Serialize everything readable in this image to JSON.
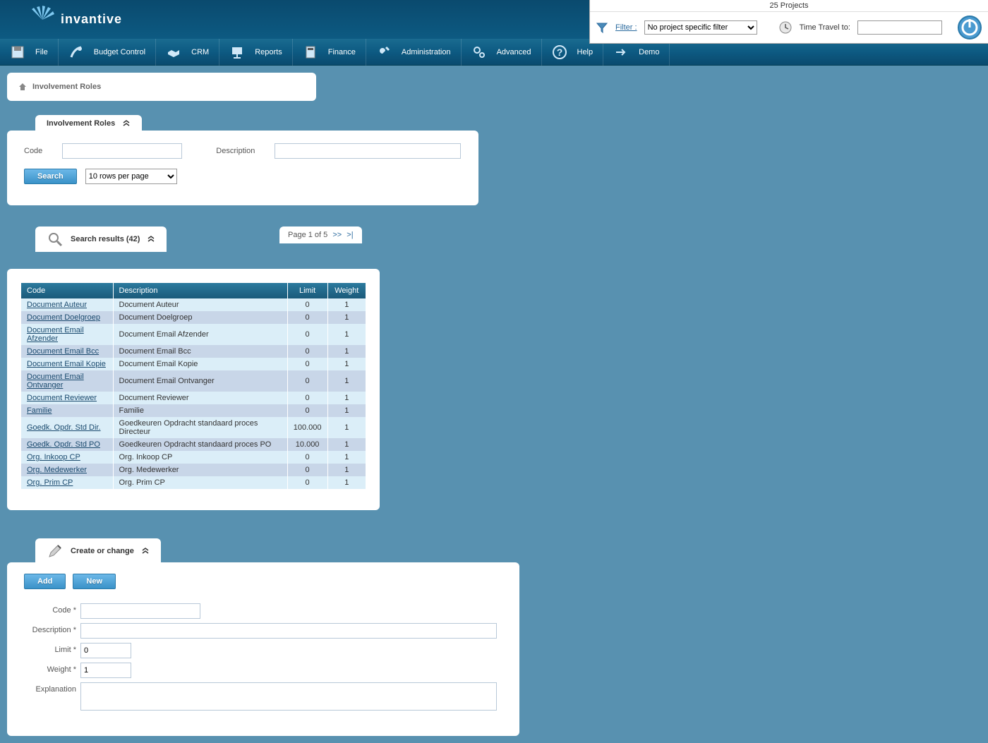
{
  "topbar": {
    "projects_count": "25 Projects",
    "filter_label": "Filter :",
    "filter_selected": "No project specific filter",
    "timetravel_label": "Time Travel to:",
    "timetravel_value": ""
  },
  "logo": {
    "text": "invantive"
  },
  "menu": [
    {
      "label": "File",
      "icon": "save"
    },
    {
      "label": "Budget Control",
      "icon": "budget"
    },
    {
      "label": "CRM",
      "icon": "handshake"
    },
    {
      "label": "Reports",
      "icon": "presentation"
    },
    {
      "label": "Finance",
      "icon": "calculator"
    },
    {
      "label": "Administration",
      "icon": "wrench"
    },
    {
      "label": "Advanced",
      "icon": "gears"
    },
    {
      "label": "Help",
      "icon": "help"
    },
    {
      "label": "Demo",
      "icon": "arrow"
    }
  ],
  "breadcrumb": {
    "title": "Involvement Roles"
  },
  "search_panel": {
    "title": "Involvement Roles",
    "code_label": "Code",
    "desc_label": "Description",
    "search_btn": "Search",
    "rows_selected": "10 rows per page"
  },
  "results": {
    "title": "Search results (42)",
    "pager": "Page 1 of 5",
    "pager_next": ">>",
    "pager_last": ">|",
    "columns": {
      "code": "Code",
      "description": "Description",
      "limit": "Limit",
      "weight": "Weight"
    },
    "rows": [
      {
        "code": "Document Auteur",
        "desc": "Document Auteur",
        "limit": "0",
        "weight": "1"
      },
      {
        "code": "Document Doelgroep",
        "desc": "Document Doelgroep",
        "limit": "0",
        "weight": "1"
      },
      {
        "code": "Document Email Afzender",
        "desc": "Document Email Afzender",
        "limit": "0",
        "weight": "1"
      },
      {
        "code": "Document Email Bcc",
        "desc": "Document Email Bcc",
        "limit": "0",
        "weight": "1"
      },
      {
        "code": "Document Email Kopie",
        "desc": "Document Email Kopie",
        "limit": "0",
        "weight": "1"
      },
      {
        "code": "Document Email Ontvanger",
        "desc": "Document Email Ontvanger",
        "limit": "0",
        "weight": "1"
      },
      {
        "code": "Document Reviewer",
        "desc": "Document Reviewer",
        "limit": "0",
        "weight": "1"
      },
      {
        "code": "Familie",
        "desc": "Familie",
        "limit": "0",
        "weight": "1"
      },
      {
        "code": "Goedk. Opdr. Std Dir.",
        "desc": "Goedkeuren Opdracht standaard proces Directeur",
        "limit": "100.000",
        "weight": "1"
      },
      {
        "code": "Goedk. Opdr. Std PO",
        "desc": "Goedkeuren Opdracht standaard proces PO",
        "limit": "10.000",
        "weight": "1"
      },
      {
        "code": "Org. Inkoop CP",
        "desc": "Org. Inkoop CP",
        "limit": "0",
        "weight": "1"
      },
      {
        "code": "Org. Medewerker",
        "desc": "Org. Medewerker",
        "limit": "0",
        "weight": "1"
      },
      {
        "code": "Org. Prim CP",
        "desc": "Org. Prim CP",
        "limit": "0",
        "weight": "1"
      }
    ]
  },
  "create_panel": {
    "title": "Create or change",
    "add_btn": "Add",
    "new_btn": "New",
    "code_label": "Code *",
    "desc_label": "Description *",
    "limit_label": "Limit *",
    "limit_value": "0",
    "weight_label": "Weight *",
    "weight_value": "1",
    "explanation_label": "Explanation"
  }
}
